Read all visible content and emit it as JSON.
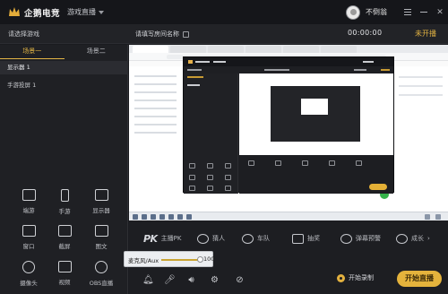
{
  "titlebar": {
    "app_name": "企鹅电竞",
    "mode_menu": "游戏直播",
    "username": "不倒翁"
  },
  "topbar": {
    "game_select": "请选择游戏",
    "room_name": "请填写房间名称",
    "timer": "00:00:00",
    "live_status": "未开播"
  },
  "sidebar": {
    "tabs": [
      {
        "label": "场景一",
        "active": true
      },
      {
        "label": "场景二",
        "active": false
      }
    ],
    "scenes": [
      {
        "label": "显示器 1",
        "selected": true
      },
      {
        "label": "手游投屏 1",
        "selected": false
      }
    ],
    "tools": [
      {
        "label": "端游",
        "icon": "gamepad-icon"
      },
      {
        "label": "手游",
        "icon": "phone-icon"
      },
      {
        "label": "显示器",
        "icon": "monitor-icon"
      },
      {
        "label": "窗口",
        "icon": "window-icon"
      },
      {
        "label": "截屏",
        "icon": "crop-icon"
      },
      {
        "label": "图文",
        "icon": "image-icon"
      },
      {
        "label": "摄像头",
        "icon": "camera-icon"
      },
      {
        "label": "视频",
        "icon": "video-icon"
      },
      {
        "label": "OBS直播",
        "icon": "obs-icon"
      }
    ]
  },
  "features": [
    {
      "label": "主播PK",
      "icon": "pk-icon"
    },
    {
      "label": "猜人",
      "icon": "guess-icon"
    },
    {
      "label": "车队",
      "icon": "team-icon"
    },
    {
      "label": "抽奖",
      "icon": "lottery-icon"
    },
    {
      "label": "弹幕预警",
      "icon": "danmaku-alert-icon"
    },
    {
      "label": "成长",
      "icon": "growth-icon"
    }
  ],
  "audio": {
    "mic_label": "麦克风/Aux",
    "mic_value": "100",
    "mic_level": 1.0
  },
  "actions": {
    "record_label": "开始录制",
    "start_live_label": "开始直播"
  },
  "colors": {
    "accent": "#e4b33c",
    "background": "#1b1c20"
  }
}
